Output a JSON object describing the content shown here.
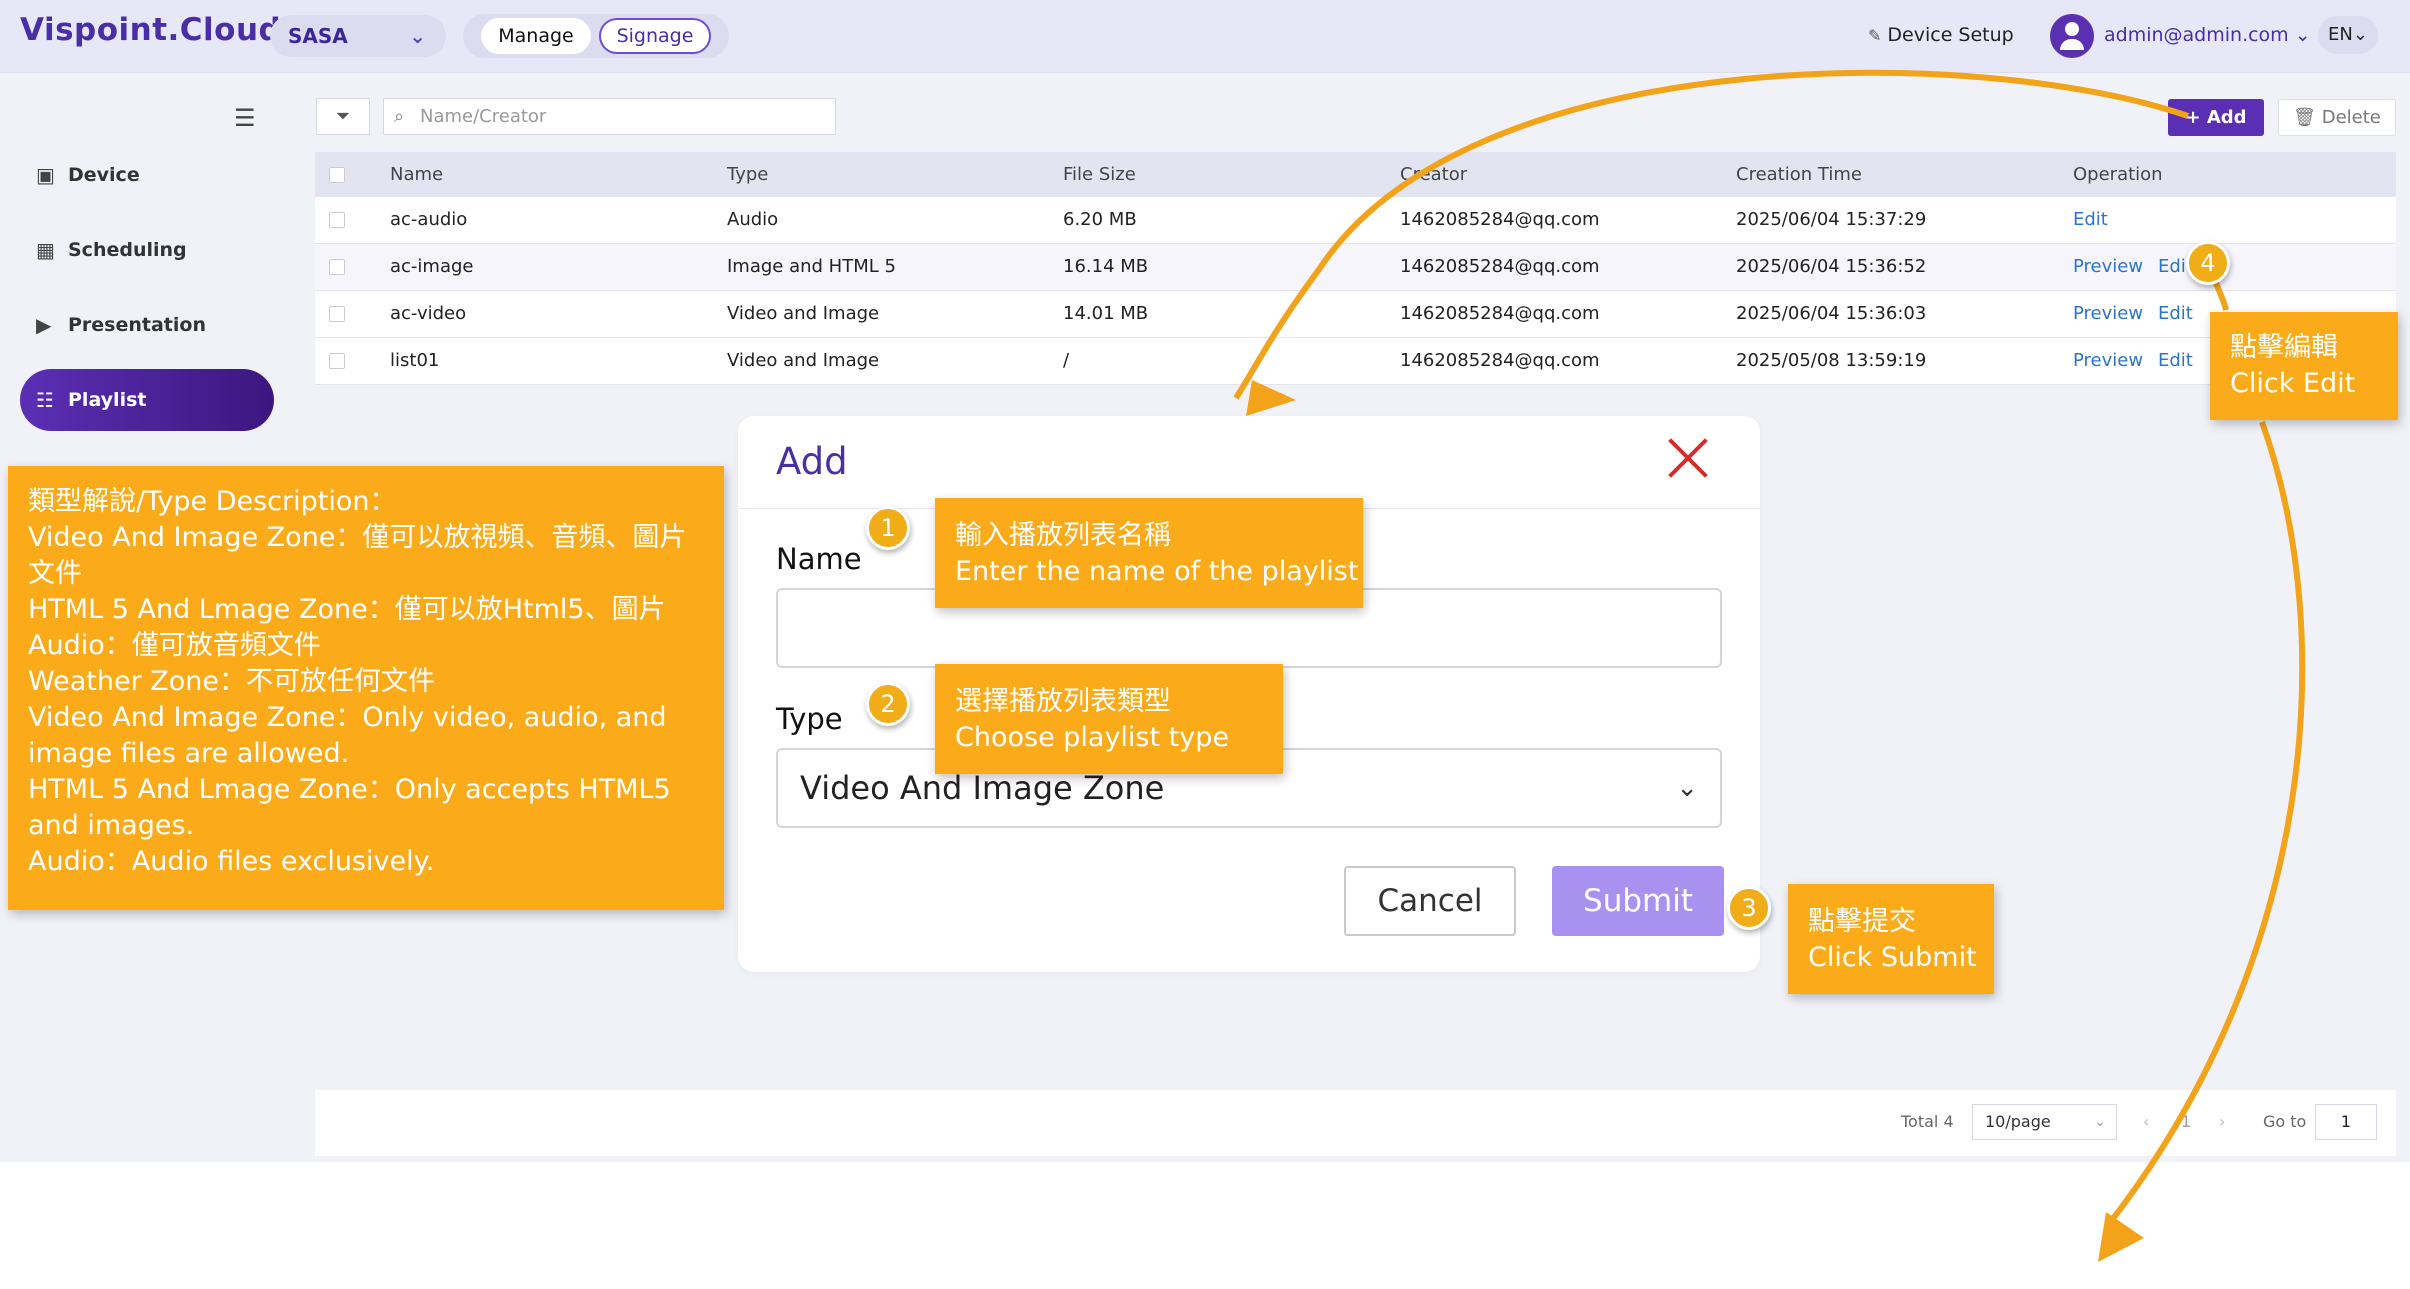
{
  "header": {
    "logo": "Vispoint.Cloud",
    "tenant": "SASA",
    "mode_manage": "Manage",
    "mode_signage": "Signage",
    "device_setup": "Device Setup",
    "user": "admin@admin.com",
    "lang": "EN"
  },
  "sidebar": {
    "items": [
      {
        "label": "Device"
      },
      {
        "label": "Scheduling"
      },
      {
        "label": "Presentation"
      },
      {
        "label": "Playlist",
        "active": true
      }
    ]
  },
  "toolbar": {
    "search_placeholder": "Name/Creator",
    "add_label": "Add",
    "delete_label": "Delete"
  },
  "table": {
    "columns": [
      "Name",
      "Type",
      "File Size",
      "Creator",
      "Creation Time",
      "Operation"
    ],
    "rows": [
      {
        "name": "ac-audio",
        "type": "Audio",
        "size": "6.20 MB",
        "creator": "1462085284@qq.com",
        "time": "2025/06/04 15:37:29",
        "preview": "",
        "edit": "Edit"
      },
      {
        "name": "ac-image",
        "type": "Image and HTML 5",
        "size": "16.14 MB",
        "creator": "1462085284@qq.com",
        "time": "2025/06/04 15:36:52",
        "preview": "Preview",
        "edit": "Edit"
      },
      {
        "name": "ac-video",
        "type": "Video and Image",
        "size": "14.01 MB",
        "creator": "1462085284@qq.com",
        "time": "2025/06/04 15:36:03",
        "preview": "Preview",
        "edit": "Edit"
      },
      {
        "name": "list01",
        "type": "Video and Image",
        "size": "/",
        "creator": "1462085284@qq.com",
        "time": "2025/05/08 13:59:19",
        "preview": "Preview",
        "edit": "Edit"
      }
    ]
  },
  "pager": {
    "total": "Total 4",
    "page_size": "10/page",
    "current_page": "1",
    "goto_label": "Go to",
    "goto_value": "1"
  },
  "modal": {
    "title": "Add",
    "name_label": "Name",
    "name_value": "",
    "type_label": "Type",
    "type_value": "Video And Image Zone",
    "cancel_label": "Cancel",
    "submit_label": "Submit"
  },
  "annotations": {
    "type_desc": [
      "類型解說/Type Description：",
      "Video And Image Zone：僅可以放視頻、音頻、圖片文件",
      "HTML 5 And Lmage Zone：僅可以放Html5、圖片",
      "Audio：僅可放音頻文件",
      "Weather Zone：不可放任何文件",
      "Video And Image Zone：Only video, audio, and image files are allowed.",
      "HTML 5 And Lmage Zone：Only accepts HTML5 and images.",
      "Audio：Audio files exclusively."
    ],
    "step1": {
      "num": "1",
      "zh": "輸入播放列表名稱",
      "en": "Enter the name of the playlist"
    },
    "step2": {
      "num": "2",
      "zh": "選擇播放列表類型",
      "en": "Choose playlist type"
    },
    "step3": {
      "num": "3",
      "zh": "點擊提交",
      "en": "Click Submit"
    },
    "step4": {
      "num": "4",
      "zh": "點擊編輯",
      "en": "Click Edit"
    }
  },
  "colors": {
    "brand": "#5b2fb4",
    "callout": "#fbab19",
    "link": "#2b74c9",
    "close": "#d62b2b"
  }
}
